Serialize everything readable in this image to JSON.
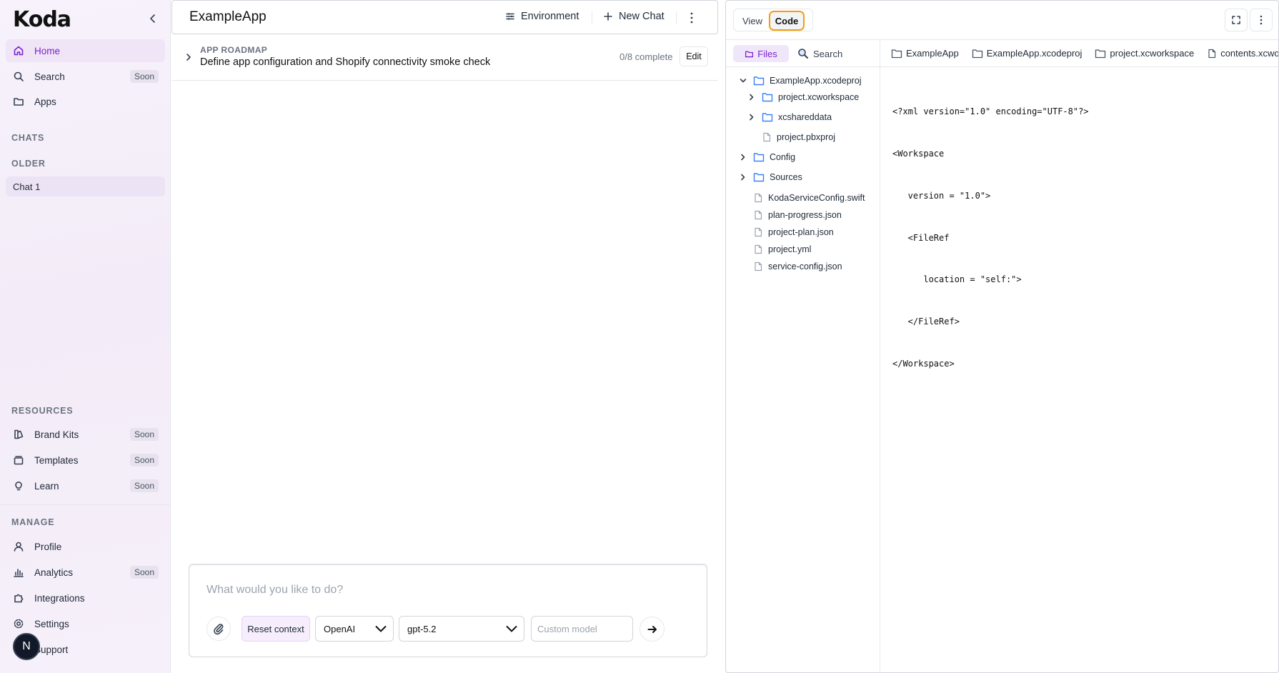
{
  "sidebar": {
    "logo": "Koda",
    "nav": [
      {
        "label": "Home",
        "active": true,
        "icon": "home-icon"
      },
      {
        "label": "Search",
        "badge": "Soon",
        "icon": "search-icon"
      },
      {
        "label": "Apps",
        "icon": "folder-icon"
      }
    ],
    "chats_heading": "CHATS",
    "older_heading": "OLDER",
    "chats": [
      {
        "label": "Chat 1"
      }
    ],
    "resources_heading": "RESOURCES",
    "resources": [
      {
        "label": "Brand Kits",
        "badge": "Soon",
        "icon": "brand-kit-icon"
      },
      {
        "label": "Templates",
        "badge": "Soon",
        "icon": "templates-icon"
      },
      {
        "label": "Learn",
        "badge": "Soon",
        "icon": "lightbulb-icon"
      }
    ],
    "manage_heading": "MANAGE",
    "manage": [
      {
        "label": "Profile",
        "icon": "user-icon"
      },
      {
        "label": "Analytics",
        "badge": "Soon",
        "icon": "analytics-icon"
      },
      {
        "label": "Integrations",
        "icon": "puzzle-icon"
      },
      {
        "label": "Settings",
        "icon": "gear-icon"
      },
      {
        "label": "Support",
        "icon": "support-icon"
      }
    ],
    "avatar_initial": "N"
  },
  "header": {
    "app_title": "ExampleApp",
    "environment_label": "Environment",
    "new_chat_label": "New Chat"
  },
  "roadmap": {
    "label": "APP ROADMAP",
    "title": "Define app configuration and Shopify connectivity smoke check",
    "progress": "0/8 complete",
    "edit_label": "Edit"
  },
  "composer": {
    "placeholder": "What would you like to do?",
    "reset_label": "Reset context",
    "provider": "OpenAI",
    "model": "gpt-5.2",
    "custom_model_placeholder": "Custom model"
  },
  "panel": {
    "view_label": "View",
    "code_label": "Code",
    "files_tab": "Files",
    "search_tab": "Search",
    "tree": [
      {
        "label": "ExampleApp.xcodeproj",
        "type": "folder",
        "expanded": true
      },
      {
        "label": "project.xcworkspace",
        "type": "folder",
        "expanded": false
      },
      {
        "label": "xcshareddata",
        "type": "folder",
        "expanded": false
      },
      {
        "label": "project.pbxproj",
        "type": "file"
      },
      {
        "label": "Config",
        "type": "folder",
        "expanded": false
      },
      {
        "label": "Sources",
        "type": "folder",
        "expanded": false
      },
      {
        "label": "KodaServiceConfig.swift",
        "type": "file"
      },
      {
        "label": "plan-progress.json",
        "type": "file"
      },
      {
        "label": "project-plan.json",
        "type": "file"
      },
      {
        "label": "project.yml",
        "type": "file"
      },
      {
        "label": "service-config.json",
        "type": "file"
      }
    ],
    "breadcrumb": [
      "ExampleApp",
      "ExampleApp.xcodeproj",
      "project.xcworkspace",
      "contents.xcworkspacedata"
    ],
    "code_lines": [
      "<?xml version=\"1.0\" encoding=\"UTF-8\"?>",
      "<Workspace",
      "   version = \"1.0\">",
      "   <FileRef",
      "      location = \"self:\">",
      "   </FileRef>",
      "</Workspace>"
    ]
  },
  "colors": {
    "accent": "#7e22ce",
    "active_bg": "#efe5f7",
    "code_toggle_border": "#f59e0b"
  }
}
